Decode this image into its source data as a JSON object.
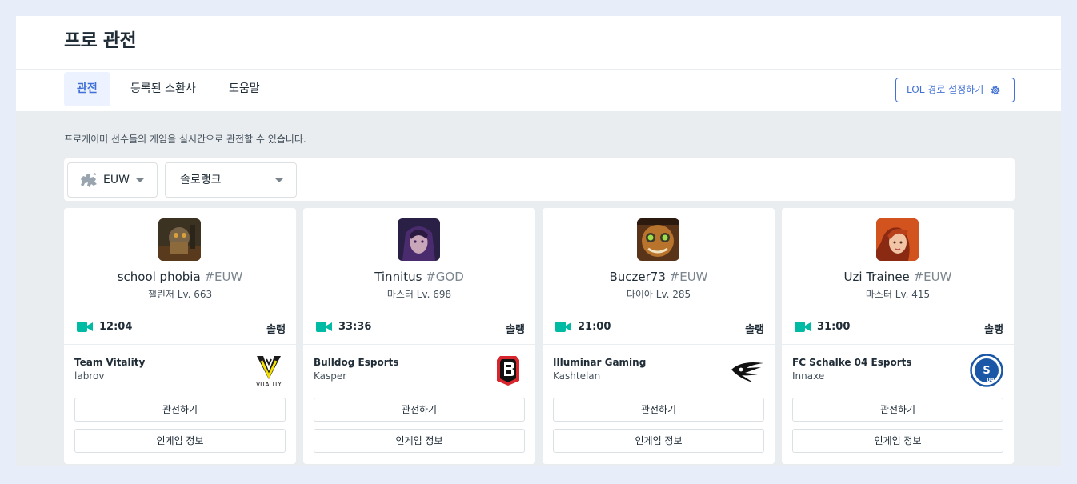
{
  "header": {
    "title": "프로 관전"
  },
  "tabs": [
    {
      "label": "관전",
      "active": true
    },
    {
      "label": "등록된 소환사",
      "active": false
    },
    {
      "label": "도움말",
      "active": false
    }
  ],
  "lol_path_button": {
    "label": "LOL 경로 설정하기",
    "icon": "gear-icon"
  },
  "description": "프로게이머 선수들의 게임을 실시간으로 관전할 수 있습니다.",
  "filters": {
    "region": {
      "value": "EUW",
      "icon": "europe-map-icon"
    },
    "queue": {
      "value": "솔로랭크"
    }
  },
  "colors": {
    "accent": "#4171d6",
    "live": "#00bba3"
  },
  "cards": [
    {
      "name": "school phobia",
      "tag": "#EUW",
      "rank": "챌린저 Lv. 663",
      "time": "12:04",
      "queue": "솔랭",
      "team": "Team Vitality",
      "player": "labrov",
      "team_logo": "vitality-logo",
      "watch_label": "관전하기",
      "info_label": "인게임 정보"
    },
    {
      "name": "Tinnitus",
      "tag": "#GOD",
      "rank": "마스터 Lv. 698",
      "time": "33:36",
      "queue": "솔랭",
      "team": "Bulldog Esports",
      "player": "Kasper",
      "team_logo": "bulldog-logo",
      "watch_label": "관전하기",
      "info_label": "인게임 정보"
    },
    {
      "name": "Buczer73",
      "tag": "#EUW",
      "rank": "다이아 Lv. 285",
      "time": "21:00",
      "queue": "솔랭",
      "team": "Illuminar Gaming",
      "player": "Kashtelan",
      "team_logo": "illuminar-logo",
      "watch_label": "관전하기",
      "info_label": "인게임 정보"
    },
    {
      "name": "Uzi Trainee",
      "tag": "#EUW",
      "rank": "마스터 Lv. 415",
      "time": "31:00",
      "queue": "솔랭",
      "team": "FC Schalke 04 Esports",
      "player": "Innaxe",
      "team_logo": "schalke-logo",
      "watch_label": "관전하기",
      "info_label": "인게임 정보"
    }
  ]
}
